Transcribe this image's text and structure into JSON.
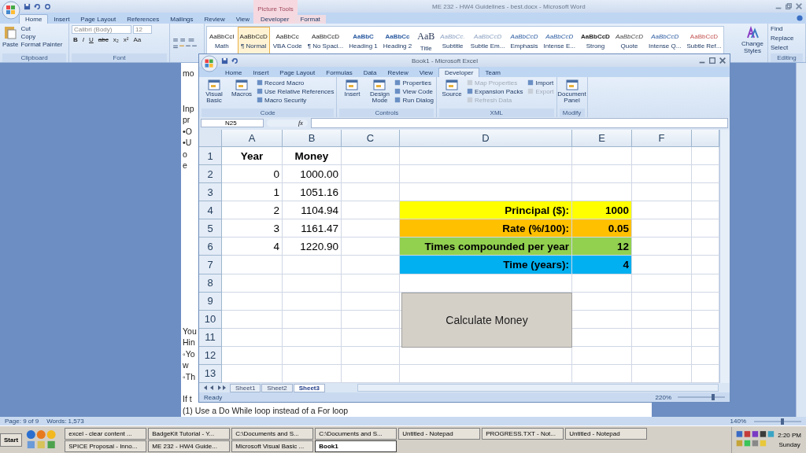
{
  "word": {
    "title": "ME 232 - HW4 Guidelines - best.docx - Microsoft Word",
    "context_tab": "Picture Tools",
    "tabs": [
      {
        "label": "Home",
        "selected": true
      },
      {
        "label": "Insert",
        "selected": false
      },
      {
        "label": "Page Layout",
        "selected": false
      },
      {
        "label": "References",
        "selected": false
      },
      {
        "label": "Mailings",
        "selected": false
      },
      {
        "label": "Review",
        "selected": false
      },
      {
        "label": "View",
        "selected": false
      },
      {
        "label": "Developer",
        "selected": false
      },
      {
        "label": "Format",
        "selected": false
      }
    ],
    "clipboard": {
      "paste": "Paste",
      "items": [
        "Cut",
        "Copy",
        "Format Painter"
      ],
      "label": "Clipboard"
    },
    "font": {
      "name": "Calibri (Body)",
      "size": "12",
      "buttons": [
        "B",
        "I",
        "U",
        "abc",
        "x₂",
        "x²",
        "Aa"
      ],
      "label": "Font"
    },
    "styles": [
      {
        "sample": "AaBbCcI",
        "name": "Math",
        "selected": false
      },
      {
        "sample": "AaBbCcD",
        "name": "¶ Normal",
        "selected": true
      },
      {
        "sample": "AaBbCc",
        "name": "VBA Code",
        "selected": false
      },
      {
        "sample": "AaBbCcD",
        "name": "¶ No Spaci...",
        "selected": false
      },
      {
        "sample": "AaBbC",
        "name": "Heading 1",
        "selected": false
      },
      {
        "sample": "AaBbCc",
        "name": "Heading 2",
        "selected": false
      },
      {
        "sample": "AaB",
        "name": "Title",
        "selected": false
      },
      {
        "sample": "AaBbCc.",
        "name": "Subtitle",
        "selected": false
      },
      {
        "sample": "AaBbCcD",
        "name": "Subtle Em...",
        "selected": false
      },
      {
        "sample": "AaBbCcD",
        "name": "Emphasis",
        "selected": false
      },
      {
        "sample": "AaBbCcD",
        "name": "Intense E...",
        "selected": false
      },
      {
        "sample": "AaBbCcD",
        "name": "Strong",
        "selected": false
      },
      {
        "sample": "AaBbCcD",
        "name": "Quote",
        "selected": false
      },
      {
        "sample": "AaBbCcD",
        "name": "Intense Q...",
        "selected": false
      },
      {
        "sample": "AaBbCcD",
        "name": "Subtle Ref...",
        "selected": false
      }
    ],
    "change_styles": "Change Styles",
    "editing": {
      "items": [
        "Find",
        "Replace",
        "Select"
      ],
      "label": "Editing"
    },
    "document_lines": [
      "mo",
      "Inp",
      "pr",
      "•O",
      "•U",
      "o",
      "e",
      "You",
      "Hin",
      "◦Yo",
      "w",
      "◦Th",
      "If t",
      "(1) Use a Do While loop instead of a For loop"
    ],
    "status_bar": {
      "page": "Page: 9 of 9",
      "words": "Words: 1,573",
      "zoom": "140%",
      "zoom_slider": {
        "level": 0.6
      }
    }
  },
  "excel": {
    "title": "Book1 - Microsoft Excel",
    "tabs": [
      {
        "label": "Home",
        "selected": false
      },
      {
        "label": "Insert",
        "selected": false
      },
      {
        "label": "Page Layout",
        "selected": false
      },
      {
        "label": "Formulas",
        "selected": false
      },
      {
        "label": "Data",
        "selected": false
      },
      {
        "label": "Review",
        "selected": false
      },
      {
        "label": "View",
        "selected": false
      },
      {
        "label": "Developer",
        "selected": true
      },
      {
        "label": "Team",
        "selected": false
      }
    ],
    "groups": [
      {
        "label": "Code",
        "large": [
          "Visual Basic",
          "Macros"
        ],
        "small": [
          {
            "label": "Record Macro",
            "disabled": false
          },
          {
            "label": "Use Relative References",
            "disabled": false
          },
          {
            "label": "Macro Security",
            "disabled": false
          }
        ]
      },
      {
        "label": "Controls",
        "large": [
          "Insert",
          "Design Mode"
        ],
        "small": [
          {
            "label": "Properties",
            "disabled": false
          },
          {
            "label": "View Code",
            "disabled": false
          },
          {
            "label": "Run Dialog",
            "disabled": false
          }
        ]
      },
      {
        "label": "XML",
        "large": [
          "Source"
        ],
        "small": [
          {
            "label": "Map Properties",
            "disabled": true
          },
          {
            "label": "Expansion Packs",
            "disabled": false
          },
          {
            "label": "Refresh Data",
            "disabled": true
          },
          {
            "label": "Import",
            "disabled": false
          },
          {
            "label": "Export",
            "disabled": true
          }
        ]
      },
      {
        "label": "Modify",
        "large": [
          "Document Panel"
        ]
      }
    ],
    "name_box": "N25",
    "function_label": "fx",
    "columns": [
      "A",
      "B",
      "C",
      "D",
      "E",
      "F"
    ],
    "rows": [
      {
        "header": "1",
        "cells": [
          {
            "text": "Year",
            "kind": "heading"
          },
          {
            "text": "Money",
            "kind": "heading"
          },
          {},
          {},
          {},
          {}
        ]
      },
      {
        "header": "2",
        "cells": [
          {
            "text": "0",
            "kind": "number"
          },
          {
            "text": "1000.00",
            "kind": "number"
          },
          {},
          {},
          {},
          {}
        ]
      },
      {
        "header": "3",
        "cells": [
          {
            "text": "1",
            "kind": "number"
          },
          {
            "text": "1051.16",
            "kind": "number"
          },
          {},
          {},
          {},
          {}
        ]
      },
      {
        "header": "4",
        "cells": [
          {
            "text": "2",
            "kind": "number"
          },
          {
            "text": "1104.94",
            "kind": "number"
          },
          {},
          {
            "text": "Principal ($):",
            "kind": "label",
            "color": "#ffff00"
          },
          {
            "text": "1000",
            "kind": "value",
            "color": "#ffff00"
          },
          {}
        ]
      },
      {
        "header": "5",
        "cells": [
          {
            "text": "3",
            "kind": "number"
          },
          {
            "text": "1161.47",
            "kind": "number"
          },
          {},
          {
            "text": "Rate (%/100):",
            "kind": "label",
            "color": "#ffc000"
          },
          {
            "text": "0.05",
            "kind": "value",
            "color": "#ffc000"
          },
          {}
        ]
      },
      {
        "header": "6",
        "cells": [
          {
            "text": "4",
            "kind": "number"
          },
          {
            "text": "1220.90",
            "kind": "number"
          },
          {},
          {
            "text": "Times compounded per year",
            "kind": "label",
            "color": "#92d050"
          },
          {
            "text": "12",
            "kind": "value",
            "color": "#92d050"
          },
          {}
        ]
      },
      {
        "header": "7",
        "cells": [
          {},
          {},
          {},
          {
            "text": "Time (years):",
            "kind": "label",
            "color": "#00b0f0"
          },
          {
            "text": "4",
            "kind": "value",
            "color": "#00b0f0"
          },
          {}
        ]
      },
      {
        "header": "8",
        "cells": [
          {},
          {},
          {},
          {},
          {},
          {}
        ]
      },
      {
        "header": "9",
        "cells": [
          {},
          {},
          {},
          {},
          {},
          {}
        ]
      },
      {
        "header": "10",
        "cells": [
          {},
          {},
          {},
          {},
          {},
          {}
        ]
      },
      {
        "header": "11",
        "cells": [
          {},
          {},
          {},
          {},
          {},
          {}
        ]
      },
      {
        "header": "12",
        "cells": [
          {},
          {},
          {},
          {},
          {},
          {}
        ]
      },
      {
        "header": "13",
        "cells": [
          {},
          {},
          {},
          {},
          {},
          {}
        ]
      }
    ],
    "sheet_button": "Calculate Money",
    "sheets": [
      {
        "label": "Sheet1",
        "selected": false
      },
      {
        "label": "Sheet2",
        "selected": false
      },
      {
        "label": "Sheet3",
        "selected": true
      }
    ],
    "status": "Ready",
    "zoom": "220%",
    "zoom_slider": {
      "level": 0.75
    }
  },
  "taskbar": {
    "start": "Start",
    "tasks": [
      {
        "label": "excel - clear content ...",
        "selected": false
      },
      {
        "label": "BadgeKit Tutorial - Y...",
        "selected": false
      },
      {
        "label": "C:\\Documents and S...",
        "selected": false
      },
      {
        "label": "C:\\Documents and S...",
        "selected": false
      },
      {
        "label": "Untitled - Notepad",
        "selected": false
      },
      {
        "label": "PROGRESS.TXT - Not...",
        "selected": false
      },
      {
        "label": "Untitled - Notepad",
        "selected": false
      },
      {
        "label": "SPICE Proposal - Inno...",
        "selected": false
      },
      {
        "label": "ME 232 - HW4 Guide...",
        "selected": false
      },
      {
        "label": "Microsoft Visual Basic ...",
        "selected": false
      },
      {
        "label": "Book1",
        "selected": true
      }
    ],
    "time": "2:20 PM",
    "day": "Sunday"
  }
}
